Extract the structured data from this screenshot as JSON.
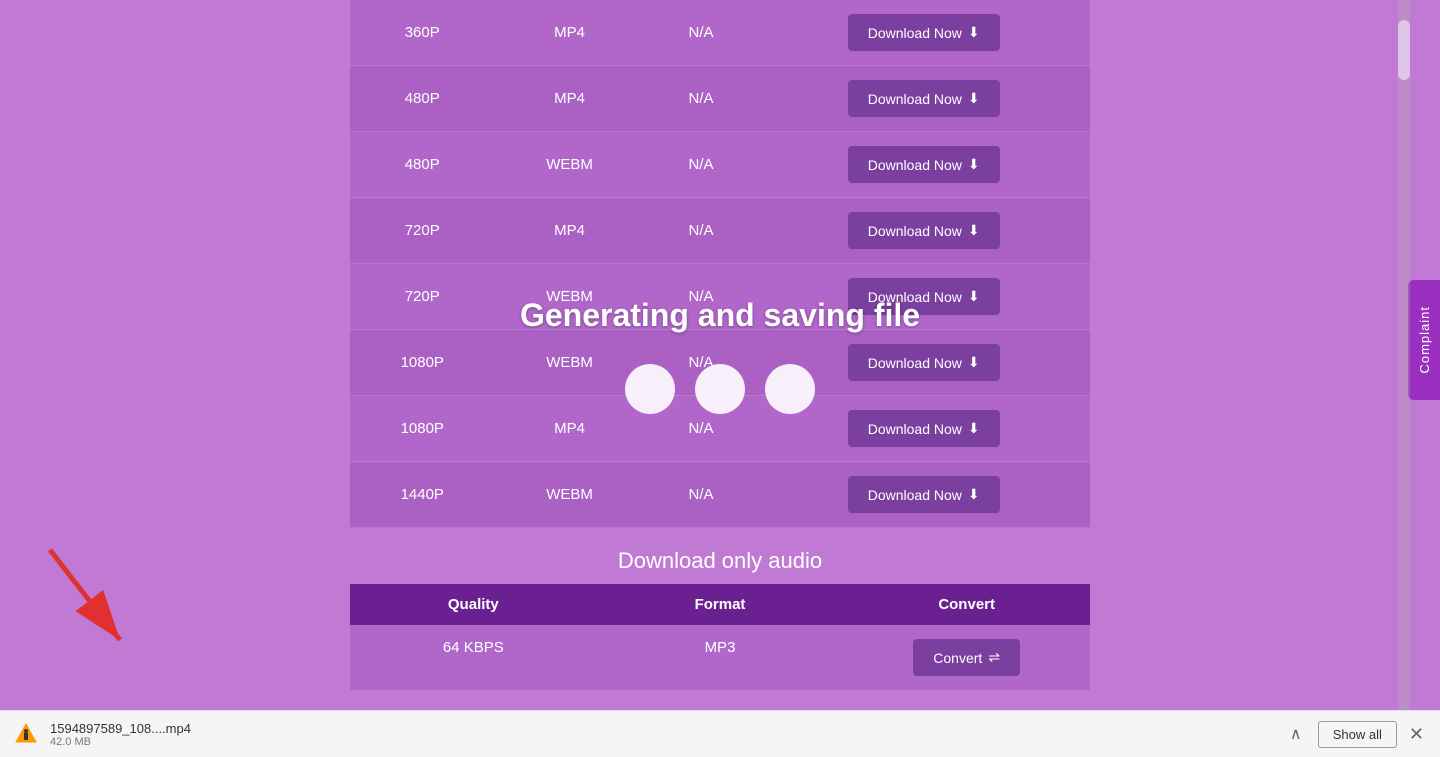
{
  "table": {
    "rows": [
      {
        "quality": "360P",
        "format": "MP4",
        "size": "N/A",
        "format_class": "mp4"
      },
      {
        "quality": "480P",
        "format": "MP4",
        "size": "N/A",
        "format_class": "mp4"
      },
      {
        "quality": "480P",
        "format": "WEBM",
        "size": "N/A",
        "format_class": "webm"
      },
      {
        "quality": "720P",
        "format": "MP4",
        "size": "N/A",
        "format_class": "mp4"
      },
      {
        "quality": "720P",
        "format": "WEBM",
        "size": "N/A",
        "format_class": "webm"
      },
      {
        "quality": "1080P",
        "format": "WEBM",
        "size": "N/A",
        "format_class": "webm"
      },
      {
        "quality": "1080P",
        "format": "MP4",
        "size": "N/A",
        "format_class": "mp4"
      },
      {
        "quality": "1440P",
        "format": "WEBM",
        "size": "N/A",
        "format_class": "webm"
      }
    ],
    "download_btn_label": "Download Now",
    "download_icon": "⬇"
  },
  "overlay": {
    "text": "Generating and saving file"
  },
  "audio_section": {
    "title": "Download only audio",
    "headers": [
      "Quality",
      "Format",
      "Convert"
    ],
    "rows": [
      {
        "quality": "64 KBPS",
        "format": "MP3",
        "convert_label": "Convert"
      }
    ],
    "convert_icon": "⇌"
  },
  "complaint_tab": {
    "label": "Complaint"
  },
  "download_bar": {
    "filename": "1594897589_108....mp4",
    "size": "42.0 MB",
    "expand_icon": "^",
    "show_all_label": "Show all",
    "close_icon": "✕"
  },
  "colors": {
    "bg": "#c07ad4",
    "btn_bg": "#7b3fa0",
    "header_bg": "#6a2090",
    "complaint_bg": "#9b30c0"
  }
}
